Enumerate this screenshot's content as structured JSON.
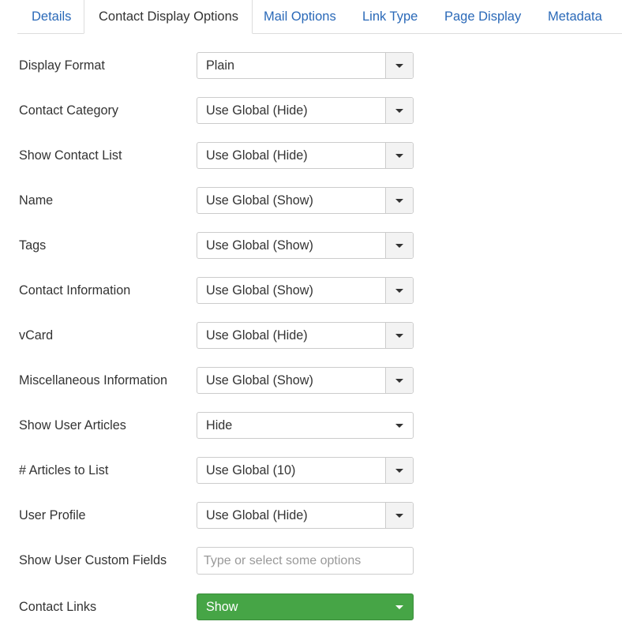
{
  "tabs": [
    {
      "label": "Details"
    },
    {
      "label": "Contact Display Options"
    },
    {
      "label": "Mail Options"
    },
    {
      "label": "Link Type"
    },
    {
      "label": "Page Display"
    },
    {
      "label": "Metadata"
    }
  ],
  "active_tab": "Contact Display Options",
  "fields": [
    {
      "label": "Display Format",
      "value": "Plain"
    },
    {
      "label": "Contact Category",
      "value": "Use Global (Hide)"
    },
    {
      "label": "Show Contact List",
      "value": "Use Global (Hide)"
    },
    {
      "label": "Name",
      "value": "Use Global (Show)"
    },
    {
      "label": "Tags",
      "value": "Use Global (Show)"
    },
    {
      "label": "Contact Information",
      "value": "Use Global (Show)"
    },
    {
      "label": "vCard",
      "value": "Use Global (Hide)"
    },
    {
      "label": "Miscellaneous Information",
      "value": "Use Global (Show)"
    },
    {
      "label": "Show User Articles",
      "value": "Hide"
    },
    {
      "label": "# Articles to List",
      "value": "Use Global (10)"
    },
    {
      "label": "User Profile",
      "value": "Use Global (Hide)"
    },
    {
      "label": "Show User Custom Fields",
      "placeholder": "Type or select some options",
      "value": ""
    },
    {
      "label": "Contact Links",
      "value": "Show"
    }
  ],
  "colors": {
    "link": "#2a69b8",
    "show_button": "#46a546"
  }
}
